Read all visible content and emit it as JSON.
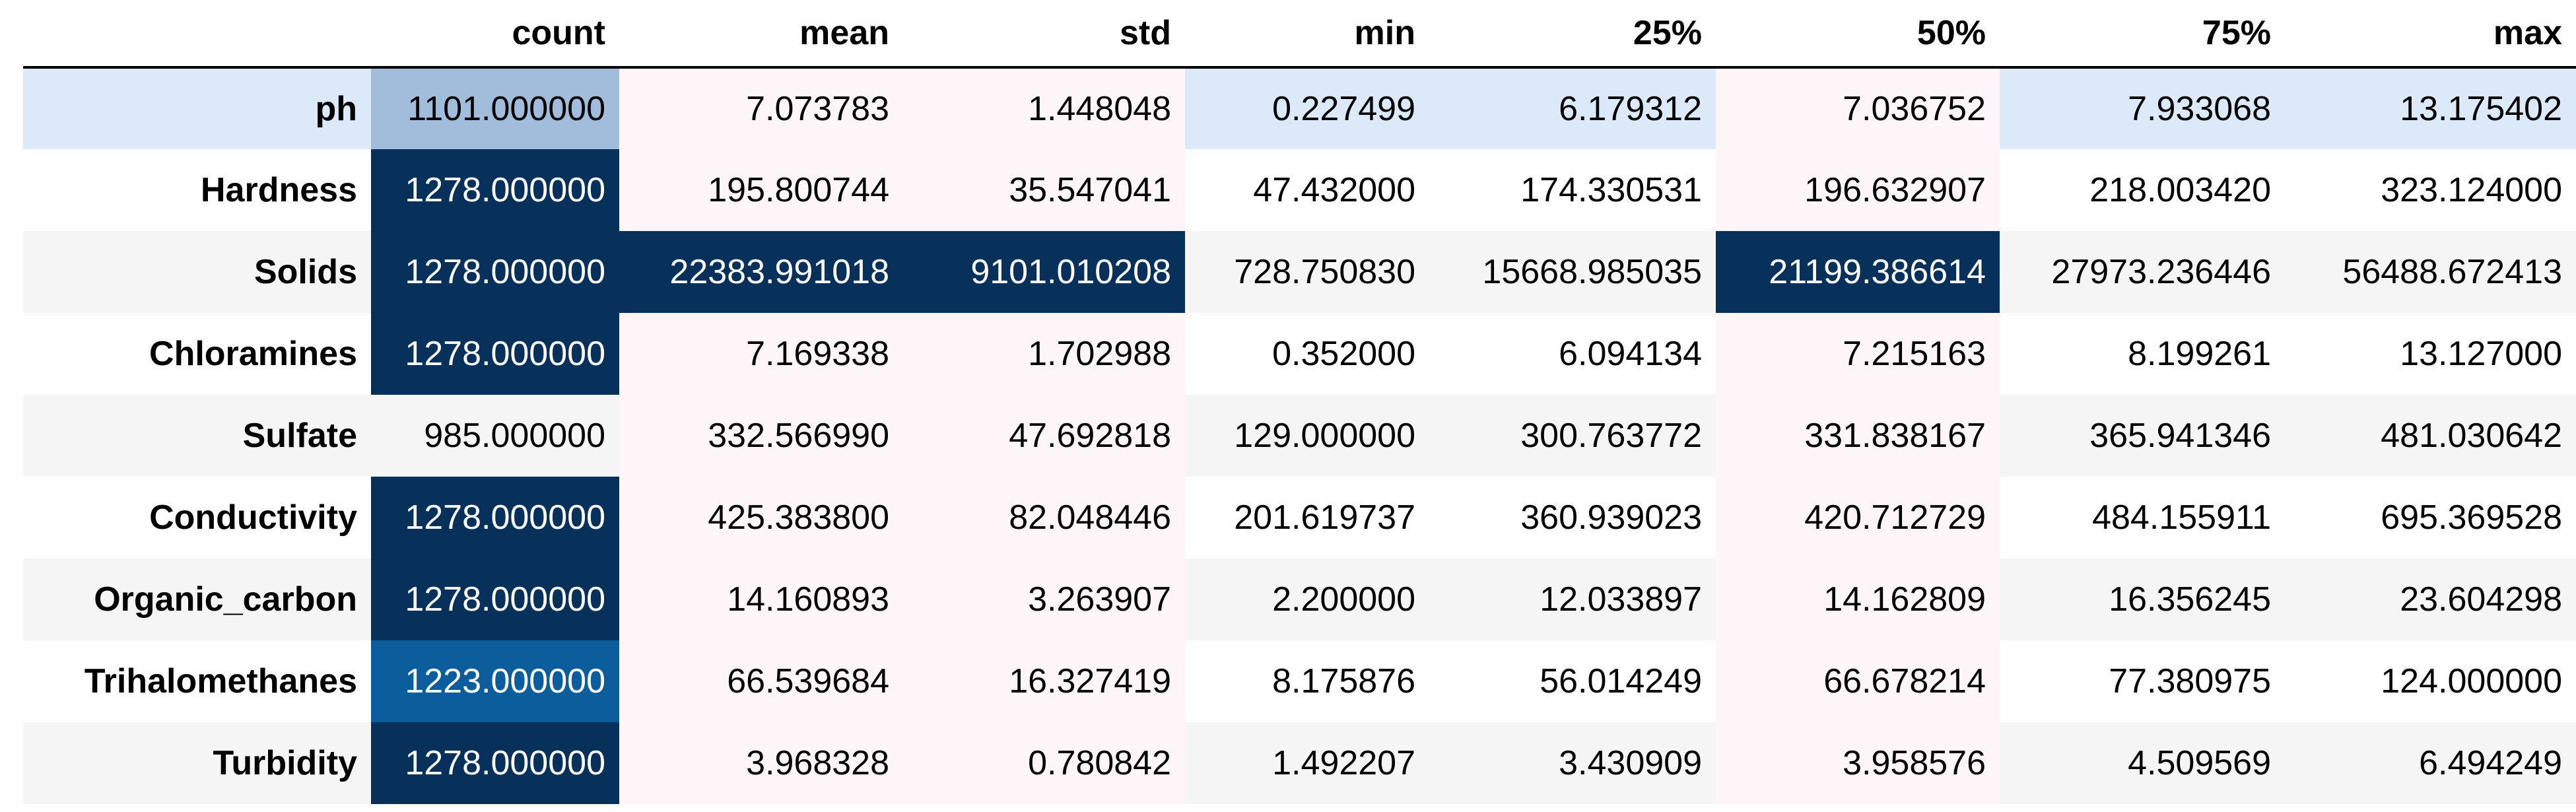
{
  "chart_data": {
    "type": "table",
    "columns": [
      "count",
      "mean",
      "std",
      "min",
      "25%",
      "50%",
      "75%",
      "max"
    ],
    "rows": [
      {
        "label": "ph",
        "values": [
          "1101.000000",
          "7.073783",
          "1.448048",
          "0.227499",
          "6.179312",
          "7.036752",
          "7.933068",
          "13.175402"
        ]
      },
      {
        "label": "Hardness",
        "values": [
          "1278.000000",
          "195.800744",
          "35.547041",
          "47.432000",
          "174.330531",
          "196.632907",
          "218.003420",
          "323.124000"
        ]
      },
      {
        "label": "Solids",
        "values": [
          "1278.000000",
          "22383.991018",
          "9101.010208",
          "728.750830",
          "15668.985035",
          "21199.386614",
          "27973.236446",
          "56488.672413"
        ]
      },
      {
        "label": "Chloramines",
        "values": [
          "1278.000000",
          "7.169338",
          "1.702988",
          "0.352000",
          "6.094134",
          "7.215163",
          "8.199261",
          "13.127000"
        ]
      },
      {
        "label": "Sulfate",
        "values": [
          "985.000000",
          "332.566990",
          "47.692818",
          "129.000000",
          "300.763772",
          "331.838167",
          "365.941346",
          "481.030642"
        ]
      },
      {
        "label": "Conductivity",
        "values": [
          "1278.000000",
          "425.383800",
          "82.048446",
          "201.619737",
          "360.939023",
          "420.712729",
          "484.155911",
          "695.369528"
        ]
      },
      {
        "label": "Organic_carbon",
        "values": [
          "1278.000000",
          "14.160893",
          "3.263907",
          "2.200000",
          "12.033897",
          "14.162809",
          "16.356245",
          "23.604298"
        ]
      },
      {
        "label": "Trihalomethanes",
        "values": [
          "1223.000000",
          "66.539684",
          "16.327419",
          "8.175876",
          "56.014249",
          "66.678214",
          "77.380975",
          "124.000000"
        ]
      },
      {
        "label": "Turbidity",
        "values": [
          "1278.000000",
          "3.968328",
          "0.780842",
          "1.492207",
          "3.430909",
          "3.958576",
          "4.509569",
          "6.494249"
        ]
      }
    ],
    "cell_colors": [
      [
        "#a2bddc",
        "#fdf5f8",
        "#fdf5f8",
        "#dbe9f8",
        "#dbe9f8",
        "#fdf5f8",
        "#dbe9f8",
        "#dbe9f8"
      ],
      [
        "#07305a",
        "#fdf5f8",
        "#fdf5f8",
        "#ffffff",
        "#ffffff",
        "#fdf5f8",
        "#ffffff",
        "#ffffff"
      ],
      [
        "#07305a",
        "#07305a",
        "#07305a",
        "#f5f5f5",
        "#f5f5f5",
        "#07305a",
        "#f5f5f5",
        "#f5f5f5"
      ],
      [
        "#07305a",
        "#fdf5f8",
        "#fdf5f8",
        "#ffffff",
        "#ffffff",
        "#fdf5f8",
        "#ffffff",
        "#ffffff"
      ],
      [
        "#f5f5f5",
        "#fdf5f8",
        "#fdf5f8",
        "#f5f5f5",
        "#f5f5f5",
        "#fdf5f8",
        "#f5f5f5",
        "#f5f5f5"
      ],
      [
        "#07305a",
        "#fdf5f8",
        "#fdf5f8",
        "#ffffff",
        "#ffffff",
        "#fdf5f8",
        "#ffffff",
        "#ffffff"
      ],
      [
        "#07305a",
        "#fdf5f8",
        "#fdf5f8",
        "#f5f5f5",
        "#f5f5f5",
        "#fdf5f8",
        "#f5f5f5",
        "#f5f5f5"
      ],
      [
        "#0b5d9b",
        "#fdf5f8",
        "#fdf5f8",
        "#ffffff",
        "#ffffff",
        "#fdf5f8",
        "#ffffff",
        "#ffffff"
      ],
      [
        "#07305a",
        "#fdf5f8",
        "#fdf5f8",
        "#f5f5f5",
        "#f5f5f5",
        "#fdf5f8",
        "#f5f5f5",
        "#f5f5f5"
      ]
    ],
    "row_colors": [
      "#dbe9f8",
      "#ffffff",
      "#f5f5f5",
      "#ffffff",
      "#f5f5f5",
      "#ffffff",
      "#f5f5f5",
      "#ffffff",
      "#f5f5f5"
    ],
    "dark_text_color": "#ffffff",
    "light_text_color": "#000000"
  }
}
